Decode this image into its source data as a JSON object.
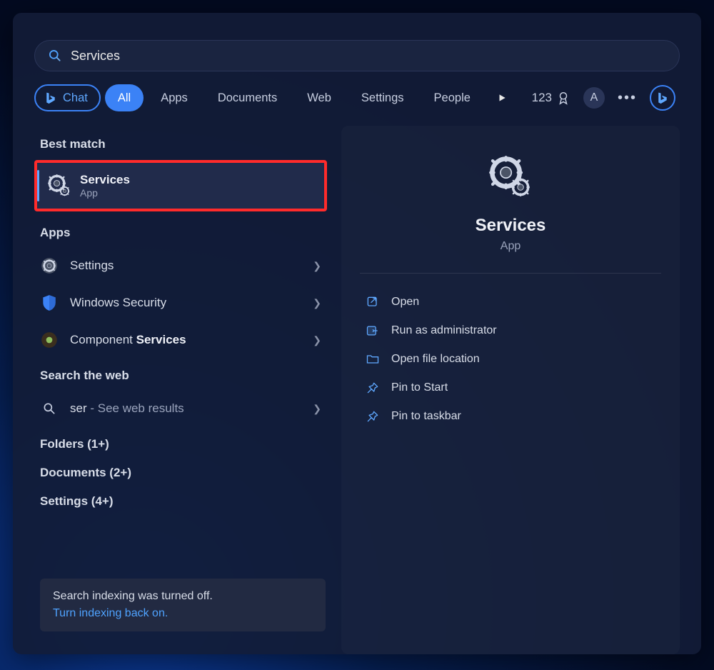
{
  "search": {
    "value": "Services"
  },
  "filters": {
    "chat": "Chat",
    "all": "All",
    "apps": "Apps",
    "documents": "Documents",
    "web": "Web",
    "settings": "Settings",
    "people": "People"
  },
  "tools": {
    "points": "123",
    "avatar_letter": "A"
  },
  "left": {
    "best_match_header": "Best match",
    "best_match": {
      "title": "Services",
      "subtitle": "App"
    },
    "apps_header": "Apps",
    "apps": [
      {
        "label": "Settings"
      },
      {
        "label": "Windows Security"
      },
      {
        "prefix": "Component ",
        "highlight": "Services"
      }
    ],
    "search_web_header": "Search the web",
    "web": {
      "prefix": "ser",
      "suffix": " - See web results"
    },
    "folders": "Folders (1+)",
    "documents": "Documents (2+)",
    "settings": "Settings (4+)"
  },
  "preview": {
    "title": "Services",
    "subtitle": "App",
    "actions": {
      "open": "Open",
      "admin": "Run as administrator",
      "location": "Open file location",
      "pin_start": "Pin to Start",
      "pin_taskbar": "Pin to taskbar"
    }
  },
  "notice": {
    "title": "Search indexing was turned off.",
    "link": "Turn indexing back on."
  }
}
